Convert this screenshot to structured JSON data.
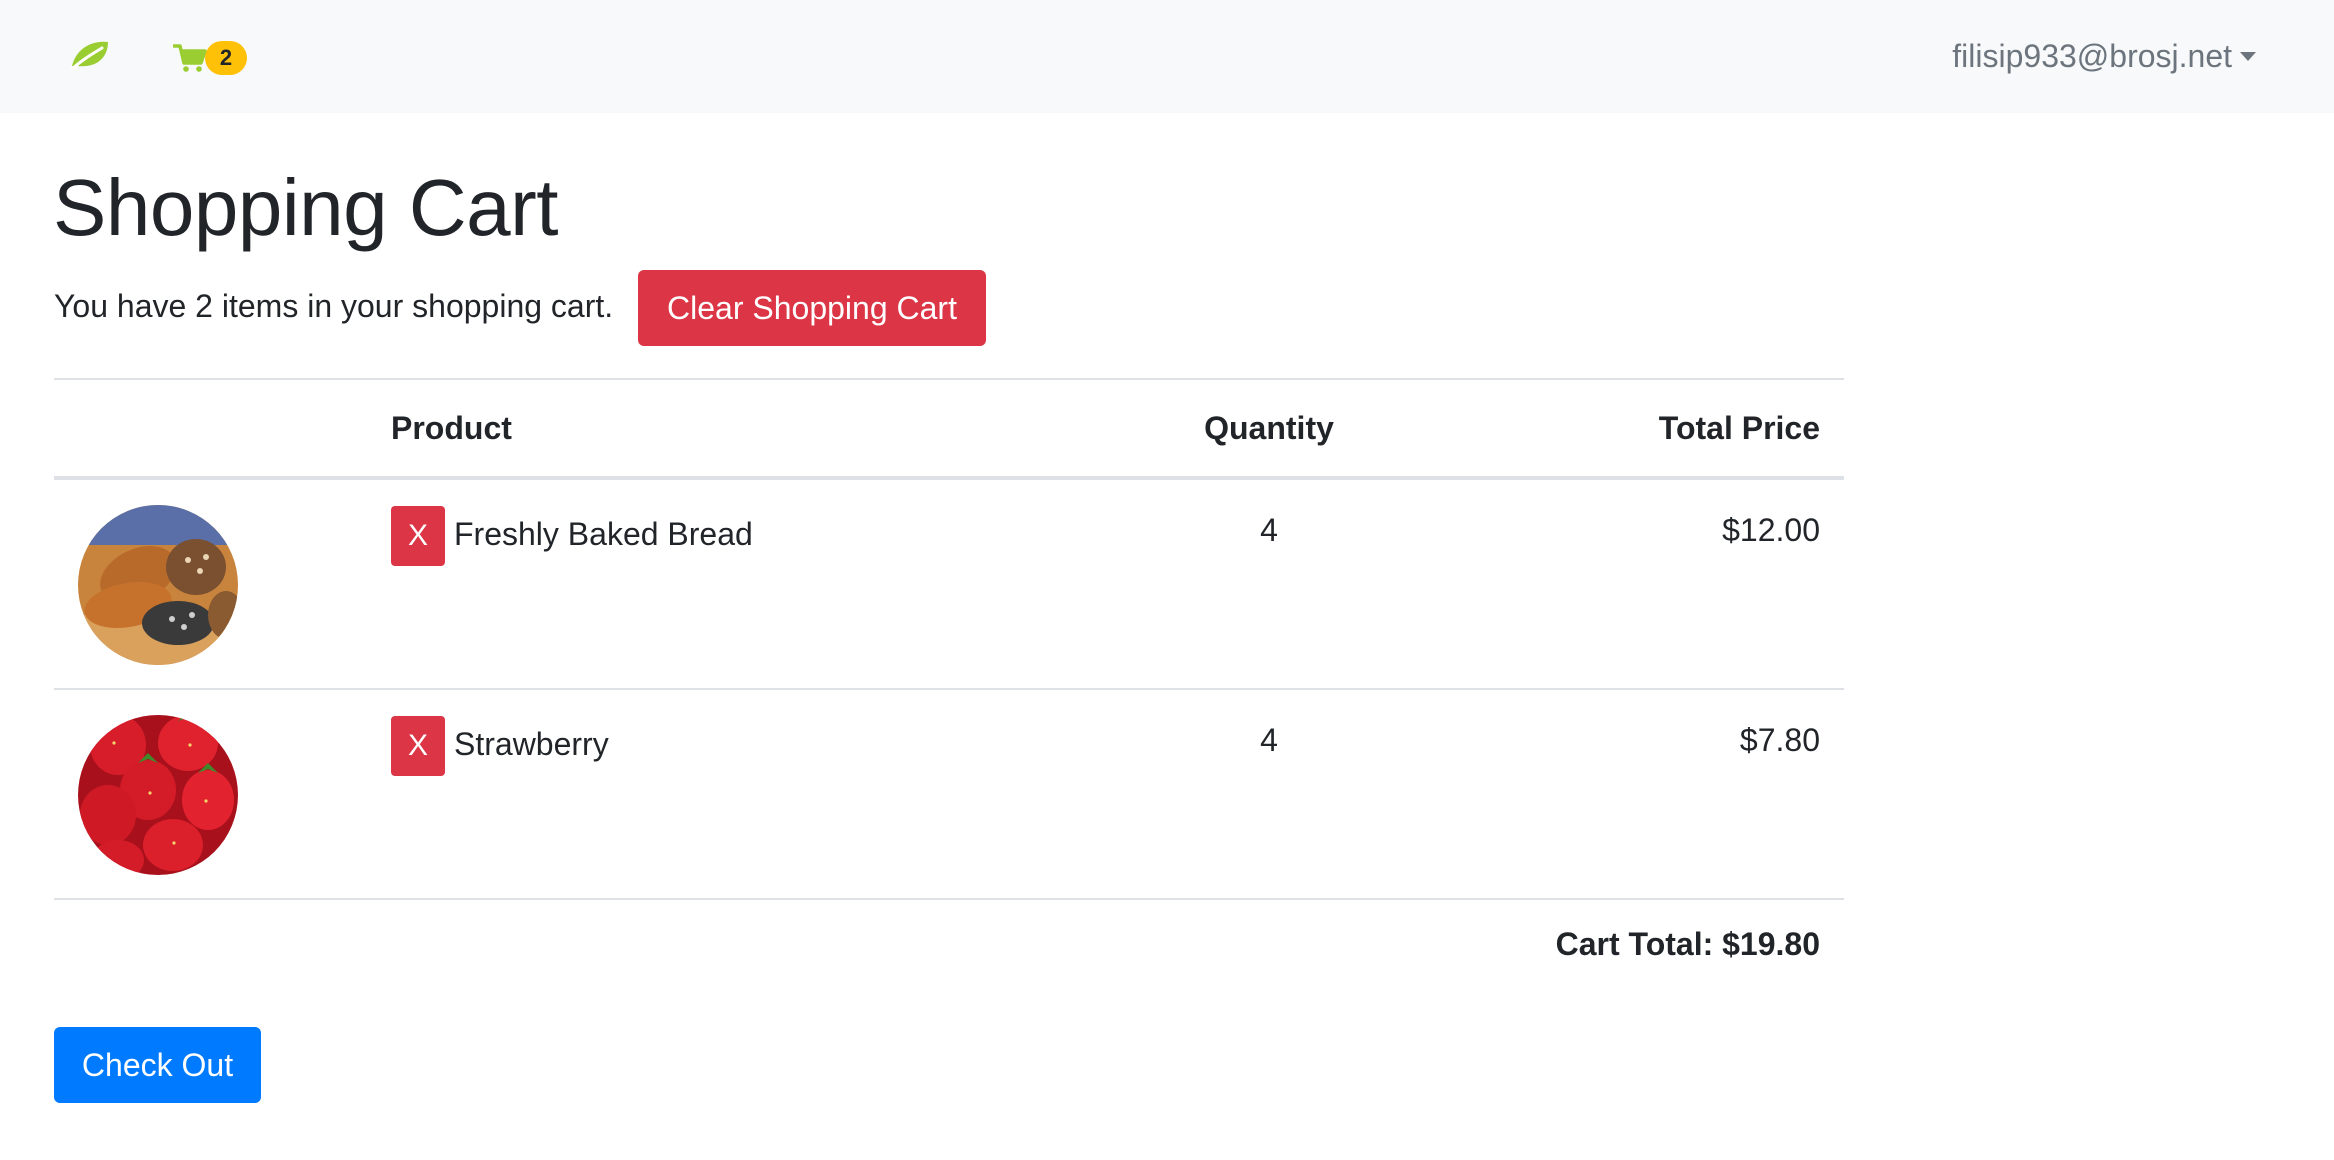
{
  "navbar": {
    "brand_icon": "leaf-icon",
    "cart_icon": "cart-icon",
    "cart_count": "2",
    "user_email": "filisip933@brosj.net",
    "colors": {
      "brand": "#9acd32",
      "badge": "#ffc107",
      "background": "#f8f9fa"
    }
  },
  "page": {
    "title": "Shopping Cart",
    "summary": "You have 2 items in your shopping cart.",
    "clear_label": "Clear Shopping Cart",
    "checkout_label": "Check Out"
  },
  "table": {
    "columns": [
      "",
      "Product",
      "Quantity",
      "Total Price"
    ],
    "rows": [
      {
        "name": "Freshly Baked Bread",
        "quantity": "4",
        "price": "$12.00",
        "remove_label": "X",
        "image": "bread-image"
      },
      {
        "name": "Strawberry",
        "quantity": "4",
        "price": "$7.80",
        "remove_label": "X",
        "image": "strawberry-image"
      }
    ],
    "total": "Cart Total: $19.80"
  },
  "colors": {
    "danger": "#dc3545",
    "primary": "#007bff",
    "text": "#212529",
    "muted": "#6c757d"
  }
}
